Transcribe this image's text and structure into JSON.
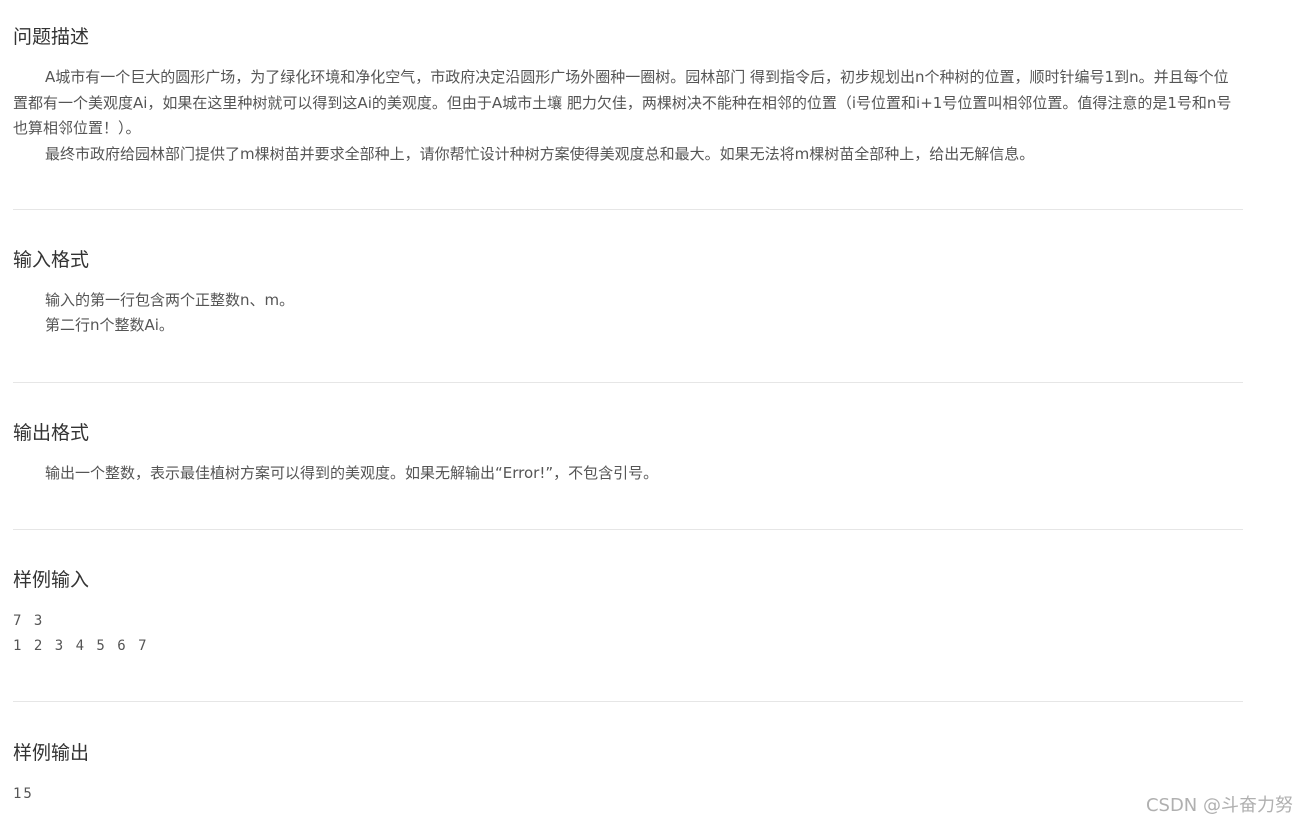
{
  "problem": {
    "title": "问题描述",
    "paragraphs": [
      "A城市有一个巨大的圆形广场，为了绿化环境和净化空气，市政府决定沿圆形广场外圈种一圈树。园林部门 得到指令后，初步规划出n个种树的位置，顺时针编号1到n。并且每个位置都有一个美观度Ai，如果在这里种树就可以得到这Ai的美观度。但由于A城市土壤 肥力欠佳，两棵树决不能种在相邻的位置（i号位置和i+1号位置叫相邻位置。值得注意的是1号和n号也算相邻位置！）。",
      "最终市政府给园林部门提供了m棵树苗并要求全部种上，请你帮忙设计种树方案使得美观度总和最大。如果无法将m棵树苗全部种上，给出无解信息。"
    ]
  },
  "input_format": {
    "title": "输入格式",
    "lines": [
      "输入的第一行包含两个正整数n、m。",
      "第二行n个整数Ai。"
    ]
  },
  "output_format": {
    "title": "输出格式",
    "lines": [
      "输出一个整数，表示最佳植树方案可以得到的美观度。如果无解输出“Error!”，不包含引号。"
    ]
  },
  "sample_input": {
    "title": "样例输入",
    "lines": [
      "7 3",
      "1 2 3 4 5 6 7"
    ]
  },
  "sample_output": {
    "title": "样例输出",
    "lines": [
      "15"
    ]
  },
  "watermark": "CSDN @斗奋力努"
}
